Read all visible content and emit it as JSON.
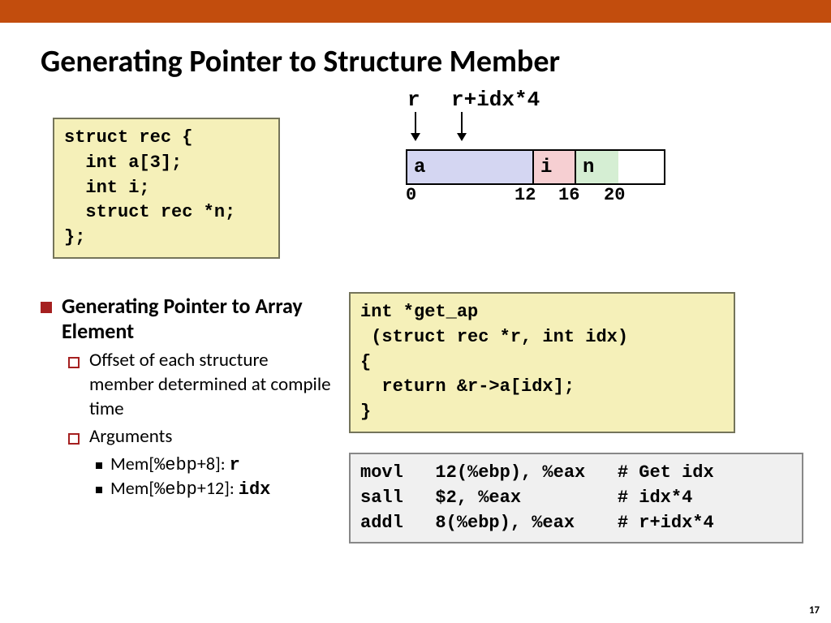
{
  "title": "Generating Pointer to Structure Member",
  "struct_code": "struct rec {\n  int a[3];\n  int i;\n  struct rec *n;\n};",
  "diagram": {
    "label_r": "r",
    "label_ridx": "r+idx*4",
    "cell_a": "a",
    "cell_i": "i",
    "cell_n": "n",
    "off0": "0",
    "off12": "12",
    "off16": "16",
    "off20": "20"
  },
  "bullets": {
    "h1": "Generating Pointer to Array Element",
    "s1": "Offset of each structure member determined at compile time",
    "s2": "Arguments",
    "a1_pre": "Mem[",
    "a1_mid": "%ebp",
    "a1_post": "+8]: ",
    "a1_val": "r",
    "a2_pre": "Mem[",
    "a2_mid": "%ebp",
    "a2_post": "+12]: ",
    "a2_val": "idx"
  },
  "func_code": "int *get_ap\n (struct rec *r, int idx)\n{\n  return &r->a[idx];\n}",
  "asm_code": "movl   12(%ebp), %eax   # Get idx\nsall   $2, %eax         # idx*4\naddl   8(%ebp), %eax    # r+idx*4",
  "page": "17"
}
